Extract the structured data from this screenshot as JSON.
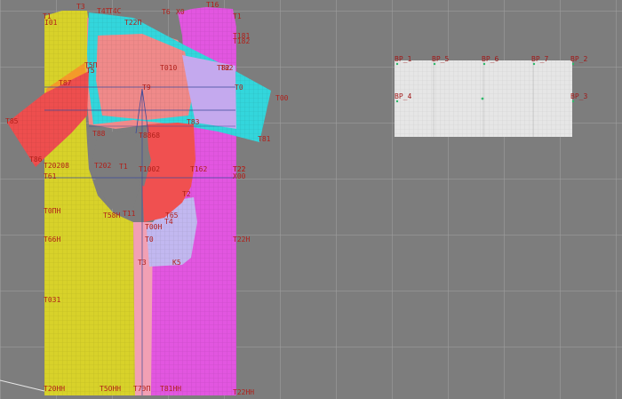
{
  "canvas": {
    "background": "#7d7d7d",
    "grid_color": "#a0a0a0"
  },
  "pattern_pieces": [
    {
      "name": "back-piece",
      "color": "#d8d22a"
    },
    {
      "name": "front-piece",
      "color": "#e256e0"
    },
    {
      "name": "back-upper-piece",
      "color": "#f08a8a"
    },
    {
      "name": "yoke-piece",
      "color": "#33d6dc"
    },
    {
      "name": "lavender-piece",
      "color": "#c4a9ee"
    },
    {
      "name": "sleeve-left-piece",
      "color": "#ee4e4e"
    },
    {
      "name": "sleeve-inner-piece",
      "color": "#f05050"
    },
    {
      "name": "center-strip-piece",
      "color": "#f2a0b4"
    },
    {
      "name": "lower-lavender-piece",
      "color": "#c2b8f0"
    },
    {
      "name": "armhole-cutout",
      "color": "#7d7d7d"
    }
  ],
  "point_labels": [
    "T1",
    "T3",
    "T4T",
    "T4C",
    "T22П",
    "T6",
    "T16",
    "I01",
    "X0",
    "T1",
    "T181",
    "T182",
    "T5П",
    "T5",
    "T010",
    "T82",
    "T82",
    "T9",
    "T0",
    "T00",
    "T85",
    "T87",
    "T88",
    "T8868",
    "T83",
    "T81",
    "T86",
    "T20208",
    "T22",
    "T202",
    "T1",
    "T1002",
    "T162",
    "T22",
    "T61",
    "X00",
    "T2",
    "T0ПН",
    "T58Н",
    "T11",
    "T65",
    "T00Н",
    "T0",
    "T66Н",
    "T22Н",
    "T3",
    "K5",
    "T4",
    "T031",
    "T20НН",
    "T5ОНН",
    "T7ЭП",
    "T81НН",
    "T22НН"
  ],
  "board": {
    "labels": [
      "BP_1",
      "BP_5",
      "BP_6",
      "BP_7",
      "BP_2",
      "BP_4",
      "BP_3"
    ]
  }
}
